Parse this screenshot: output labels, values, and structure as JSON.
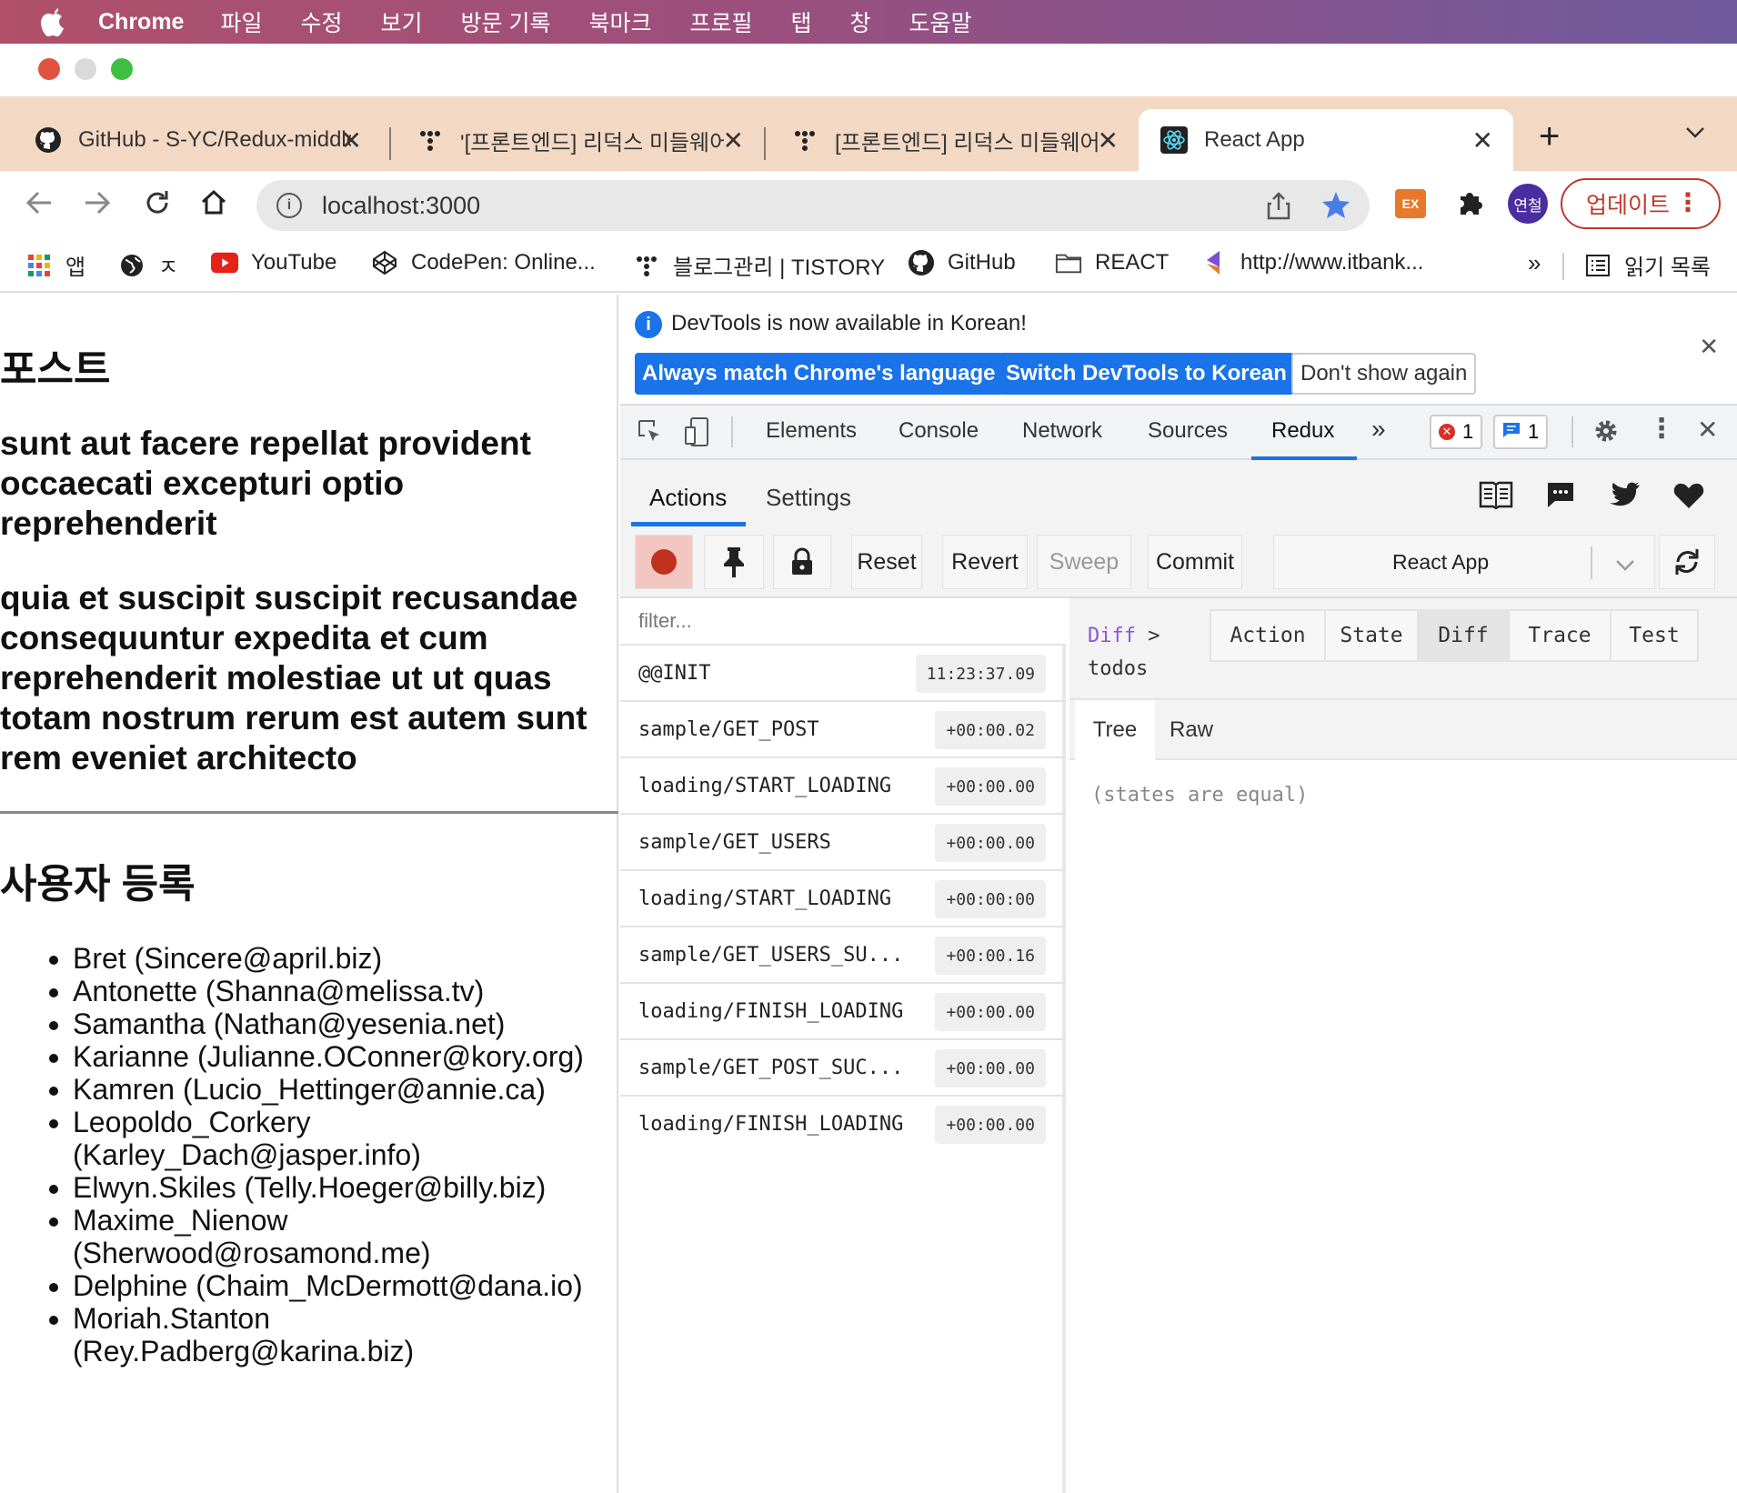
{
  "menubar": {
    "app": "Chrome",
    "items": [
      "파일",
      "수정",
      "보기",
      "방문 기록",
      "북마크",
      "프로필",
      "탭",
      "창",
      "도움말"
    ]
  },
  "tabs": [
    {
      "title": "GitHub - S-YC/Redux-middleware",
      "icon": "github-icon"
    },
    {
      "title": "'[프론트엔드] 리덕스 미들웨어",
      "icon": "tistory-icon"
    },
    {
      "title": "[프론트엔드] 리덕스 미들웨어",
      "icon": "tistory-icon"
    },
    {
      "title": "React App",
      "icon": "react-icon",
      "active": true
    }
  ],
  "toolbar": {
    "url": "localhost:3000",
    "profile": "연철",
    "update_label": "업데이트",
    "ext_label": "EX"
  },
  "bookmarks": {
    "apps": "앱",
    "items": [
      "ㅈ",
      "YouTube",
      "CodePen: Online...",
      "블로그관리 | TISTORY",
      "GitHub",
      "REACT",
      "http://www.itbank..."
    ],
    "overflow": "»",
    "reading_list": "읽기 목록"
  },
  "page": {
    "post_heading": "포스트",
    "post_title": "sunt aut facere repellat provident occaecati excepturi optio reprehenderit",
    "post_body": "quia et suscipit suscipit recusandae consequuntur expedita et cum reprehenderit molestiae ut ut quas totam nostrum rerum est autem sunt rem eveniet architecto",
    "users_heading": "사용자 등록",
    "users": [
      "Bret (Sincere@april.biz)",
      "Antonette (Shanna@melissa.tv)",
      "Samantha (Nathan@yesenia.net)",
      "Karianne (Julianne.OConner@kory.org)",
      "Kamren (Lucio_Hettinger@annie.ca)",
      "Leopoldo_Corkery (Karley_Dach@jasper.info)",
      "Elwyn.Skiles (Telly.Hoeger@billy.biz)",
      "Maxime_Nienow (Sherwood@rosamond.me)",
      "Delphine (Chaim_McDermott@dana.io)",
      "Moriah.Stanton (Rey.Padberg@karina.biz)"
    ]
  },
  "devtools": {
    "notice": "DevTools is now available in Korean!",
    "btn_match": "Always match Chrome's language",
    "btn_switch": "Switch DevTools to Korean",
    "btn_dont": "Don't show again",
    "tabs": [
      "Elements",
      "Console",
      "Network",
      "Sources",
      "Redux"
    ],
    "more": "»",
    "errors": "1",
    "messages": "1"
  },
  "redux": {
    "tabs": [
      "Actions",
      "Settings"
    ],
    "buttons": {
      "reset": "Reset",
      "revert": "Revert",
      "sweep": "Sweep",
      "commit": "Commit"
    },
    "instance": "React App",
    "filter_placeholder": "filter...",
    "actions": [
      {
        "name": "@@INIT",
        "time": "11:23:37.09"
      },
      {
        "name": "sample/GET_POST",
        "time": "+00:00.02"
      },
      {
        "name": "loading/START_LOADING",
        "time": "+00:00.00"
      },
      {
        "name": "sample/GET_USERS",
        "time": "+00:00.00"
      },
      {
        "name": "loading/START_LOADING",
        "time": "+00:00:00"
      },
      {
        "name": "sample/GET_USERS_SU...",
        "time": "+00:00.16"
      },
      {
        "name": "loading/FINISH_LOADING",
        "time": "+00:00.00"
      },
      {
        "name": "sample/GET_POST_SUC...",
        "time": "+00:00.00"
      },
      {
        "name": "loading/FINISH_LOADING",
        "time": "+00:00.00"
      }
    ],
    "crumb_diff": "Diff",
    "crumb_sep": ">",
    "crumb_path": "todos",
    "monitor_tabs": [
      "Action",
      "State",
      "Diff",
      "Trace",
      "Test"
    ],
    "view_tabs": [
      "Tree",
      "Raw"
    ],
    "equal_text": "(states are equal)"
  },
  "colors": {
    "accent": "#1a73e8",
    "record": "#c0321e",
    "update_border": "#c0392b",
    "profile_bg": "#4a2ea0"
  }
}
